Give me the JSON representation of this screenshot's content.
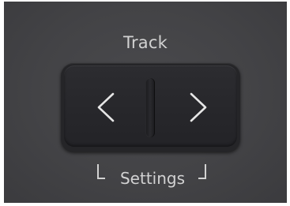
{
  "control": {
    "title": "Track",
    "sublabel": "Settings"
  },
  "buttons": {
    "previous_icon": "chevron-left-icon",
    "next_icon": "chevron-right-icon"
  },
  "colors": {
    "panel": "#434346",
    "button": "#2a2a2e",
    "text": "#d2d2d2"
  }
}
